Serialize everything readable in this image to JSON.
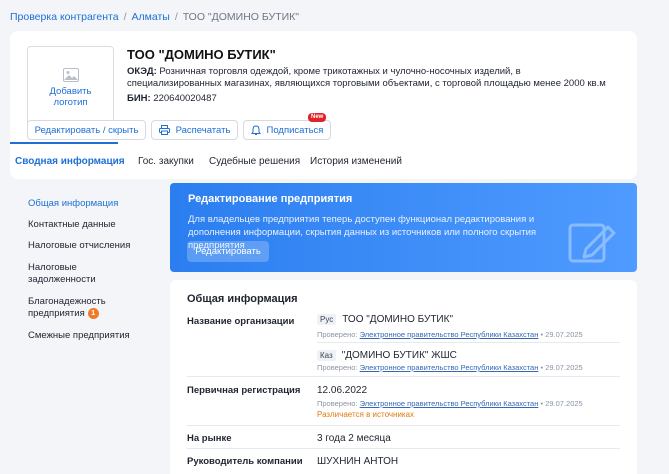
{
  "breadcrumb": {
    "items": [
      "Проверка контрагента",
      "Алматы"
    ],
    "current": "ТОО \"ДОМИНО БУТИК\"",
    "separator": "/"
  },
  "company": {
    "logo_label": "Добавить логотип",
    "name": "ТОО \"ДОМИНО БУТИК\"",
    "oked_label": "ОКЭД:",
    "oked_text": "Розничная торговля одеждой, кроме трикотажных и чулочно-носочных изделий, в специализированных магазинах, являющихся торговыми объектами, с торговой площадью менее 2000 кв.м",
    "bin_label": "БИН:",
    "bin_value": "220640020487"
  },
  "actions": {
    "edit_hide": "Редактировать / скрыть",
    "print": "Распечатать",
    "subscribe": "Подписаться",
    "new_badge": "New"
  },
  "tabs": [
    {
      "label": "Сводная информация",
      "active": true
    },
    {
      "label": "Гос. закупки",
      "active": false
    },
    {
      "label": "Судебные решения",
      "active": false
    },
    {
      "label": "История изменений",
      "active": false
    }
  ],
  "sidebar": {
    "items": [
      {
        "label": "Общая информация"
      },
      {
        "label": "Контактные данные"
      },
      {
        "label": "Налоговые отчисления"
      },
      {
        "label": "Налоговые задолженности"
      },
      {
        "label": "Благонадежность предприятия",
        "badge": "1"
      },
      {
        "label": "Смежные предприятия"
      }
    ]
  },
  "promo": {
    "title": "Редактирование предприятия",
    "text": "Для владельцев предприятия теперь доступен функционал редактирования и дополнения информации, скрытия данных из источников или полного скрытия предприятия",
    "button": "Редактировать"
  },
  "info": {
    "title": "Общая информация",
    "verified_prefix": "Проверено:",
    "source": "Электронное правительство Республики Казахстан",
    "verified_date": "• 29.07.2025",
    "org_name_label": "Название организации",
    "name_ru_tag": "Рус",
    "name_ru": "ТОО \"ДОМИНО БУТИК\"",
    "name_kz_tag": "Каз",
    "name_kz": "\"ДОМИНО БУТИК\" ЖШС",
    "reg_label": "Первичная регистрация",
    "reg_value": "12.06.2022",
    "reg_diff": "Различается в источниках",
    "market_label": "На рынке",
    "market_value": "3 года 2 месяца",
    "head_label": "Руководитель компании",
    "head_value": "ШУХНИН АНТОН"
  },
  "colors": {
    "accent": "#1f6fd6",
    "badge_red": "#e0222a",
    "badge_orange": "#f07c2a",
    "warning": "#e07a12"
  }
}
